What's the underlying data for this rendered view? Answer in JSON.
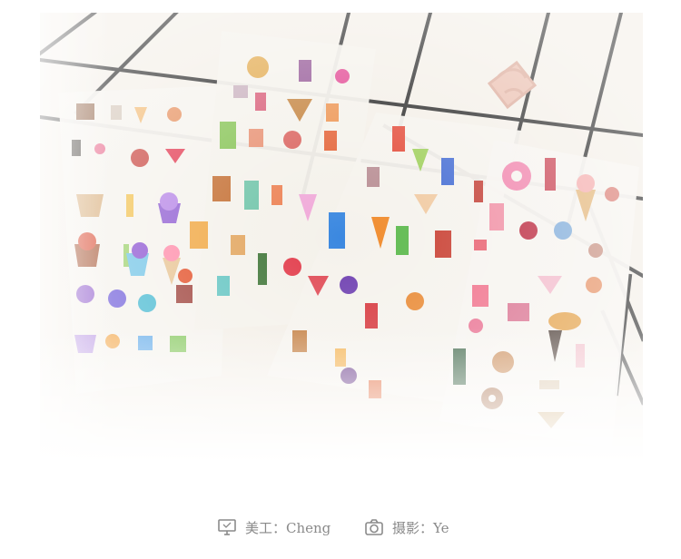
{
  "photo": {
    "subject": "stickers-photo",
    "colors": {
      "grid_background": "#f3eee6",
      "grid_lines": "#1a1a1a",
      "sheet": "#f4f1ec",
      "binder_clip": "#d9a391"
    }
  },
  "credits": {
    "designer": {
      "icon": "monitor-icon",
      "label": "美工：Cheng"
    },
    "photographer": {
      "icon": "camera-icon",
      "label": "摄影：Ye"
    }
  }
}
